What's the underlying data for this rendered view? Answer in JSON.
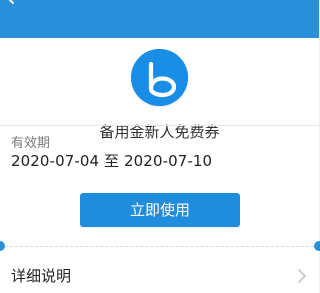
{
  "header": {
    "back_icon": "arrow-left-icon"
  },
  "coupon": {
    "logo_icon": "letter-b-logo-icon",
    "name": "备用金新人免费券",
    "validity_label": "有效期",
    "validity_range": "2020-07-04 至 2020-07-10",
    "use_button_label": "立即使用"
  },
  "details": {
    "label": "详细说明",
    "chevron_icon": "chevron-right-icon"
  },
  "colors": {
    "accent": "#2A8FDB",
    "logo": "#1A8EE6",
    "button": "#1F8DDC"
  }
}
